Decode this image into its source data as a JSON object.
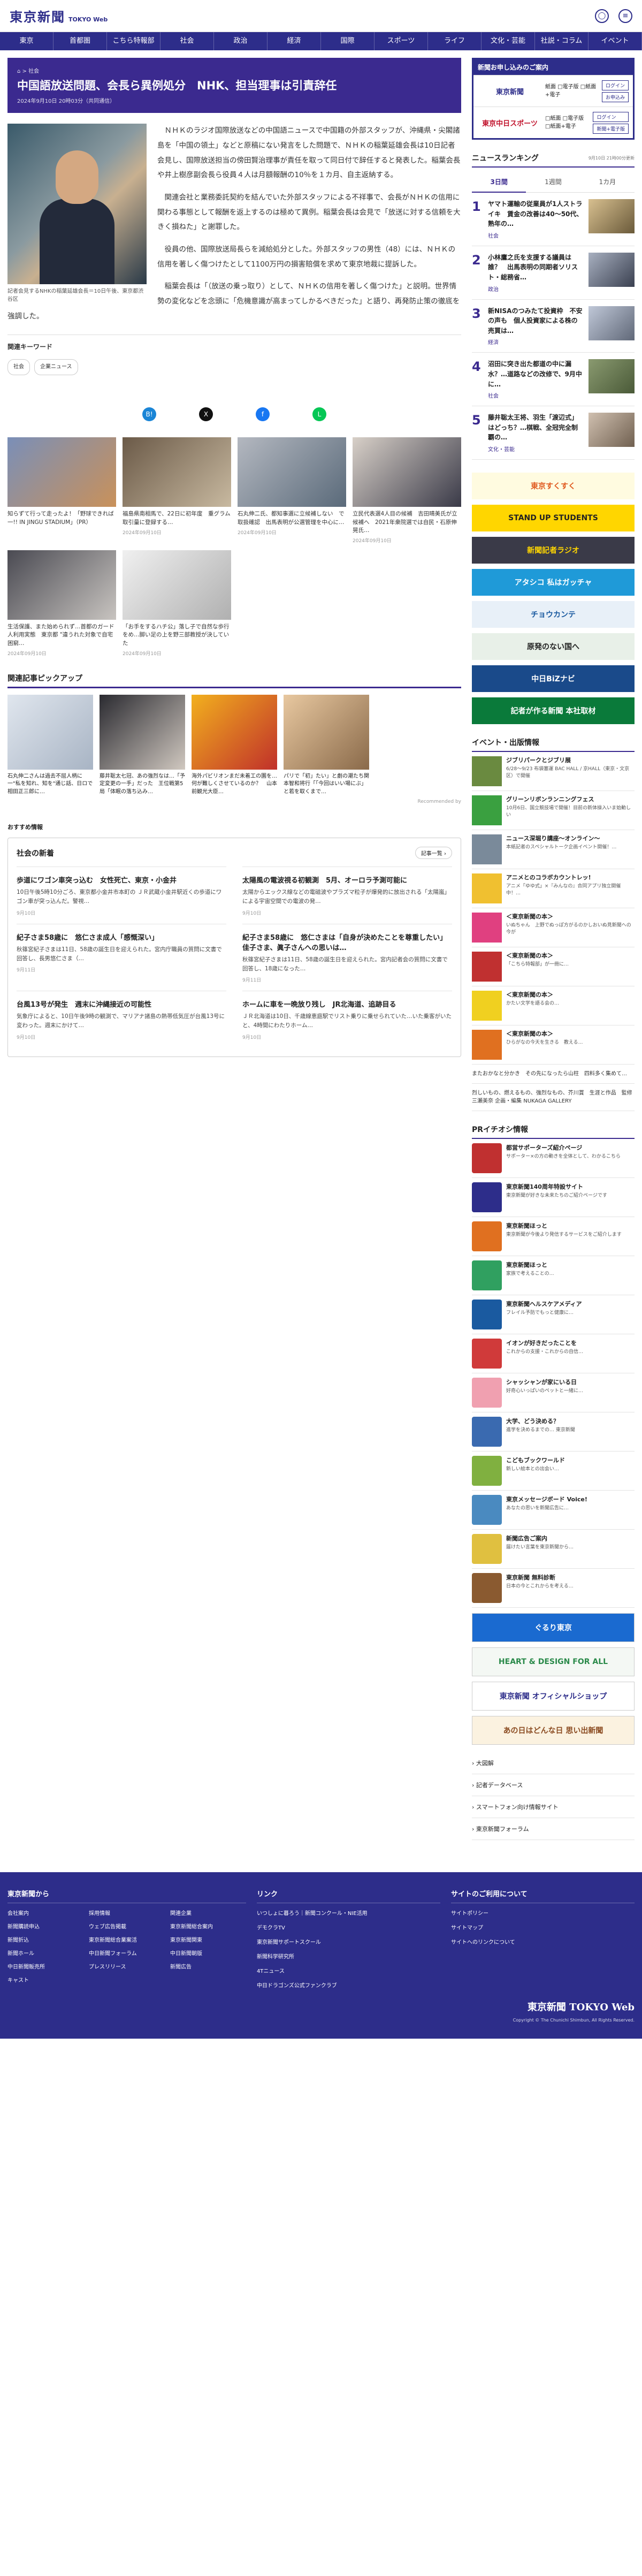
{
  "header": {
    "logo": "東京新聞",
    "logo_sub": "TOKYO Web"
  },
  "nav": [
    "社会",
    "政治",
    "経済",
    "国際",
    "スポーツ",
    "ライフ",
    "文化・芸能",
    "社説・コラム",
    "イベント",
    "東京",
    "首都圏",
    "こちら特報部",
    "社会"
  ],
  "nav_main": [
    "東京",
    "首都圏",
    "こちら特報部",
    "社会",
    "政治",
    "経済",
    "国際",
    "スポーツ",
    "ライフ",
    "文化・芸能",
    "社説・コラム",
    "イベント"
  ],
  "article": {
    "crumb": "⌂ > 社会",
    "title": "中国語放送問題、会長ら異例処分　NHK、担当理事は引責辞任",
    "published": "2024年9月10日 20時03分（共同通信）",
    "caption": "記者会見するNHKの稲葉延雄会長＝10日午後、東京都渋谷区",
    "p1": "ＮＨＫのラジオ国際放送などの中国語ニュースで中国籍の外部スタッフが、沖縄県・尖閣諸島を「中国の領土」などと原稿にない発言をした問題で、ＮＨＫの稲葉延雄会長は10日記者会見し、国際放送担当の傍田賢治理事が責任を取って同日付で辞任すると発表した。稲葉会長や井上樹彦副会長ら役員４人は月額報酬の10％を１カ月、自主返納する。",
    "p2": "関連会社と業務委託契約を結んでいた外部スタッフによる不祥事で、会長がＮＨＫの信用に関わる事態として報酬を返上するのは極めて異例。稲葉会長は会見で「放送に対する信頼を大きく損ねた」と謝罪した。",
    "p3": "役員の他、国際放送局長らを減給処分とした。外部スタッフの男性（48）には、ＮＨＫの信用を著しく傷つけたとして1100万円の損害賠償を求めて東京地裁に提訴した。",
    "p4": "稲葉会長は「（放送の乗っ取り）として、ＮＨＫの信用を著しく傷つけた」と説明。世界情勢の変化などを念頭に「危機意識が高まってしかるべきだった」と語り、再発防止策の徹底を強調した。"
  },
  "keywords": {
    "title": "関連キーワード",
    "tags": [
      "社会",
      "企業ニュース"
    ]
  },
  "share": [
    {
      "icon": "hatena-icon",
      "glyph": "B!",
      "color": "#1a85d6"
    },
    {
      "icon": "x-icon",
      "glyph": "X",
      "color": "#111"
    },
    {
      "icon": "facebook-icon",
      "glyph": "f",
      "color": "#1877f2"
    },
    {
      "icon": "line-icon",
      "glyph": "L",
      "color": "#06c755"
    }
  ],
  "related": [
    {
      "t": "知らずて行って走ったよ！「野球できれば一!! IN JINGU STADIUM」（PR）",
      "d": "",
      "c1": "#7a8fb8",
      "c2": "#c9915a"
    },
    {
      "t": "福島県南相馬で、22日に初年度　重グラム取引量に登録する…",
      "d": "2024年09月10日",
      "c1": "#6b5a48",
      "c2": "#c8b9a0"
    },
    {
      "t": "石丸伸二氏、都知事選に立候補しない　で取扱確認　出馬表明が公選管理を中心に…",
      "d": "2024年09月10日",
      "c1": "#b4b8c0",
      "c2": "#5a6a7a"
    },
    {
      "t": "立民代表選4人目の候補　吉田晴美氏が立候補へ　2021年衆院選では自民・石原伸晃氏…",
      "d": "2024年09月10日",
      "c1": "#d8d0c8",
      "c2": "#3a3a48"
    },
    {
      "t": "生活保護、また始められず…首都のガード人利用実態　東京都 \"違うれた対象で自宅困窮…",
      "d": "2024年09月10日",
      "c1": "#4a4a52",
      "c2": "#c8c4c0"
    },
    {
      "t": "「お手をするハチ公」落し子で自然な歩行をめ…脚い足の上を野三部教授が決していた",
      "d": "2024年09月10日",
      "c1": "#f0f0f0",
      "c2": "#b0b0b0"
    }
  ],
  "pickup": {
    "title": "関連記事ピックアップ",
    "items": [
      {
        "t": "石丸伸二さんは過去不屈人柄に一\"私を知れ、知を\"通じ話、日ロで　相田正三郎に…",
        "c1": "#e0e6ee",
        "c2": "#a8b4c4"
      },
      {
        "t": "藤井聡太七冠、あの強烈なは…「予定変更の一手」だった　王位戦第5局「体眠の落ち込み…",
        "c1": "#2a2a30",
        "c2": "#d0c8c0"
      },
      {
        "t": "海外パビリオンまだ未着工の園を…何が難しくさせているのか？　山本前観光大臣…",
        "c1": "#f2b01e",
        "c2": "#c0302a"
      },
      {
        "t": "パリで「初」たい」と劇の潮たち関本智和将行「「今回はいい場にぶ」と若を取くまで…",
        "c1": "#e8c8a0",
        "c2": "#8a6a4a"
      },
      {
        "t": "",
        "c1": "#fff",
        "c2": "#fff"
      }
    ],
    "rec": "Recommended by"
  },
  "recommend_label": "おすすめ情報",
  "social": {
    "title": "社会の新着",
    "more": "記事一覧 ›",
    "items": [
      {
        "t": "歩道にワゴン車突っ込む　女性死亡、東京・小金井",
        "b": "10日午後5時10分ごろ、東京都小金井市本町の ＪＲ武蔵小金井駅近くの歩道にワゴン車が突っ込んだ。警視…",
        "d": "9月10日"
      },
      {
        "t": "太陽風の電波視る初観測　5月、オーロラ予測可能に",
        "b": "太陽からエックス線などの電磁波やプラズマ粒子が爆発的に放出される「太陽嵐」による宇宙空間での電波の発…",
        "d": "9月10日"
      },
      {
        "t": "紀子さま58歳に　悠仁さま成人「感慨深い」",
        "b": "秋篠宮紀子さまは11日、58歳の誕生日を迎えられた。宮内庁職員の質問に文書で回答し、長男悠仁さま（…",
        "d": "9月11日"
      },
      {
        "t": "紀子さま58歳に　悠仁さまは「自身が決めたことを尊重したい」　佳子さま、眞子さんへの思いは…",
        "b": "秋篠宮紀子さまは11日、58歳の誕生日を迎えられた。宮内記者会の質問に文書で回答し、18歳になった…",
        "d": "9月11日"
      },
      {
        "t": "台風13号が発生　週末に沖縄接近の可能性",
        "b": "気象庁によると、10日午後9時の観測で、マリアナ諸島の熱帯低気圧が台風13号に変わった。週末にかけて…",
        "d": "9月10日"
      },
      {
        "t": "ホームに車を一晩放り残し　JR北海道、追跡目る",
        "b": "ＪＲ北海道は10日、千歳線恵庭駅でリスト乗りに乗せられていた…いた乗客がいたと、4時間にわたりホーム…",
        "d": "9月10日"
      }
    ]
  },
  "subscribe": {
    "head": "新聞お申し込みのご案内",
    "rows": [
      {
        "logo": "東京新聞",
        "color": "#2d2d8a",
        "opts": "紙面 □電子版 □紙面+電子",
        "btns": [
          "ログイン",
          "お申込み"
        ]
      },
      {
        "logo": "東京中日スポーツ",
        "color": "#c0102a",
        "opts": "□紙面 □電子版 □紙面+電子",
        "btns": [
          "ログイン",
          "新聞+電子版"
        ]
      }
    ]
  },
  "ranking": {
    "title": "ニュースランキング",
    "updated": "9月10日 21時00分更新",
    "tabs": [
      "3日間",
      "1週間",
      "1カ月"
    ],
    "items": [
      {
        "n": "1",
        "t": "ヤマト運輸の従業員が1人ストライキ　賃金の改善は40〜50代、熟年の…",
        "c": "社会",
        "c1": "#d8c090",
        "c2": "#6a5a3a"
      },
      {
        "n": "2",
        "t": "小林鷹之氏を支援する議員は誰？　出馬表明の同期者ソリスト・総務省…",
        "c": "政治",
        "c1": "#a8b0c0",
        "c2": "#3a4050"
      },
      {
        "n": "3",
        "t": "新NISAのつみたて投資枠　不安の声も　個人投資家による株の売買は…",
        "c": "経済",
        "c1": "#c0c8d8",
        "c2": "#606878"
      },
      {
        "n": "4",
        "t": "沼田に突き出た都道の中に漏水？…道路などの改修で、9月中に…",
        "c": "社会",
        "c1": "#8a9a70",
        "c2": "#4a5a38"
      },
      {
        "n": "5",
        "t": "藤井聡太王将、羽生「渡辺式」はどっち？…棋戦、全冠完全制覇の…",
        "c": "文化・芸能",
        "c1": "#d0c0b0",
        "c2": "#706050"
      }
    ]
  },
  "banners": [
    {
      "t": "東京すくすく",
      "bg": "#fffbe0",
      "fg": "#e05a20"
    },
    {
      "t": "STAND UP STUDENTS",
      "bg": "#ffd600",
      "fg": "#222"
    },
    {
      "t": "新聞記者ラジオ",
      "bg": "#3a3a48",
      "fg": "#ffd600"
    },
    {
      "t": "アタシコ 私はガッチャ",
      "bg": "#1f9ad8",
      "fg": "#fff"
    },
    {
      "t": "チョウカンテ",
      "bg": "#e8f0f8",
      "fg": "#1a5aa0"
    },
    {
      "t": "原発のない国へ",
      "bg": "#e8f0e8",
      "fg": "#222"
    },
    {
      "t": "中日BiZナビ",
      "bg": "#1a4a8a",
      "fg": "#fff"
    },
    {
      "t": "記者が作る新聞 本社取材",
      "bg": "#0a7a3a",
      "fg": "#fff"
    }
  ],
  "events": {
    "title": "イベント・出版情報",
    "items": [
      {
        "t": "ジブリパークとジブリ展",
        "s": "6/28〜9/23 布袋塞運 BAC HALL / 京HALL（東京・文京区）で開催",
        "c": "#6a8a40"
      },
      {
        "t": "グリーンリボンランニングフェス",
        "s": "10月6日、国立競技場で開催！目前の新体操入いま始動しい",
        "c": "#3aa040"
      },
      {
        "t": "ニュース深堀り講座〜オンライン〜",
        "s": "本紙記者のスペシャルトーク企画イベント開催！…",
        "c": "#7a8a9a"
      },
      {
        "t": "アニメとのコラボカウントレッ!",
        "s": "アニメ「ゆゆ式」×『みんなの』合同アプリ独立開催中！…",
        "c": "#f0c030"
      },
      {
        "t": "＜東京新聞の本＞",
        "s": "いぬちゃん　上野でぬっぽ方がるのかしおいぬ見新聞への今が",
        "c": "#e04080"
      },
      {
        "t": "＜東京新聞の本＞",
        "s": "「こちら特報部」が一冊に…",
        "c": "#c03030"
      },
      {
        "t": "＜東京新聞の本＞",
        "s": "かたい文学を語る会の…",
        "c": "#f0d020"
      },
      {
        "t": "＜東京新聞の本＞",
        "s": "ひらがなの今天を生きる　教える…",
        "c": "#e07020"
      }
    ],
    "plain": [
      "またおかなと分かき　その先になったら山柱　四料多く集めて…",
      "烈しいもの、燃えるもの、強烈なもの、芥川賞　生涯と作品　監修 三瀬美奈 企画・編集 NUKAGA GALLERY"
    ]
  },
  "pr": {
    "title": "PRイチオシ情報",
    "items": [
      {
        "t": "都営サポーターズ紹介ページ",
        "s": "サポーター×の方の動きを全体として、わかるこちら",
        "c": "#c03030"
      },
      {
        "t": "東京新聞140周年特設サイト",
        "s": "東京新聞が好きな未来たちのご紹介ページです",
        "c": "#2d2d8a"
      },
      {
        "t": "東京新聞ほっと",
        "s": "東京新聞が今後より発信するサービスをご紹介します",
        "c": "#e07020"
      },
      {
        "t": "東京新聞ほっと",
        "s": "家族で考えることの…",
        "c": "#30a060"
      },
      {
        "t": "東京新聞ヘルスケアメディア",
        "s": "フレイル予防でもっと健康に…",
        "c": "#1a5aa0"
      },
      {
        "t": "イオンが好きだったことを",
        "s": "これからの支援・これからの自信…",
        "c": "#d03a3a"
      },
      {
        "t": "シャッシャンが家にいる日",
        "s": "好奇心いっぱいのペットと一緒に…",
        "c": "#f0a0b0"
      },
      {
        "t": "大学、どう決める？",
        "s": "進学を決めるまでの… 東京新聞",
        "c": "#3a6ab0"
      },
      {
        "t": "こどもブックワールド",
        "s": "新しい絵本との出会い…",
        "c": "#80b040"
      },
      {
        "t": "東京メッセージボード Voice!",
        "s": "あなたの思いを新聞広告に…",
        "c": "#4a8ac0"
      },
      {
        "t": "新聞広告ご案内",
        "s": "届けたい言葉を東京新聞から…",
        "c": "#e0c040"
      },
      {
        "t": "東京新聞 無料診断",
        "s": "日本の今とこれからを考える…",
        "c": "#8a5a30"
      }
    ]
  },
  "pr_banners": [
    {
      "t": "ぐるり東京",
      "bg": "#1a6ad0",
      "fg": "#fff"
    },
    {
      "t": "HEART & DESIGN FOR ALL",
      "bg": "#f4f8f4",
      "fg": "#2a8a4a"
    },
    {
      "t": "東京新聞 オフィシャルショップ",
      "bg": "#fff",
      "fg": "#2d2d8a"
    },
    {
      "t": "あの日はどんな日 思い出新聞",
      "bg": "#fbf2e0",
      "fg": "#8a4a20"
    }
  ],
  "side_links": [
    "大図解",
    "記者データベース",
    "スマートフォン向け情報サイト",
    "東京新聞フォーラム"
  ],
  "footer": {
    "col1": {
      "title": "東京新聞から",
      "links": [
        "会社案内",
        "採用情報",
        "関連企業",
        "新聞購読申込",
        "ウェブ広告掲載",
        "東京新聞総合案内",
        "新聞折込",
        "東京新聞総合業案活",
        "東京新聞関東",
        "新聞ホール",
        "中日新聞フォーラム",
        "中日新聞朝版",
        "中日新聞販売所",
        "プレスリリース",
        "新聞広告",
        "キャスト"
      ]
    },
    "col2": {
      "title": "リンク",
      "links": [
        "いつしょに暮ろう｜新聞コンクール・NIE活用",
        "デモクラTV",
        "東京新聞サポートスクール",
        "新聞科学研究所",
        "4Tニュース",
        "中日ドラゴンズ公式ファンクラブ"
      ]
    },
    "col3": {
      "title": "サイトのご利用について",
      "links": [
        "サイトポリシー",
        "サイトマップ",
        "サイトへのリンクについて"
      ]
    },
    "logo": "東京新聞 TOKYO Web",
    "copy": "Copyright © The Chunichi Shimbun, All Rights Reserved."
  }
}
